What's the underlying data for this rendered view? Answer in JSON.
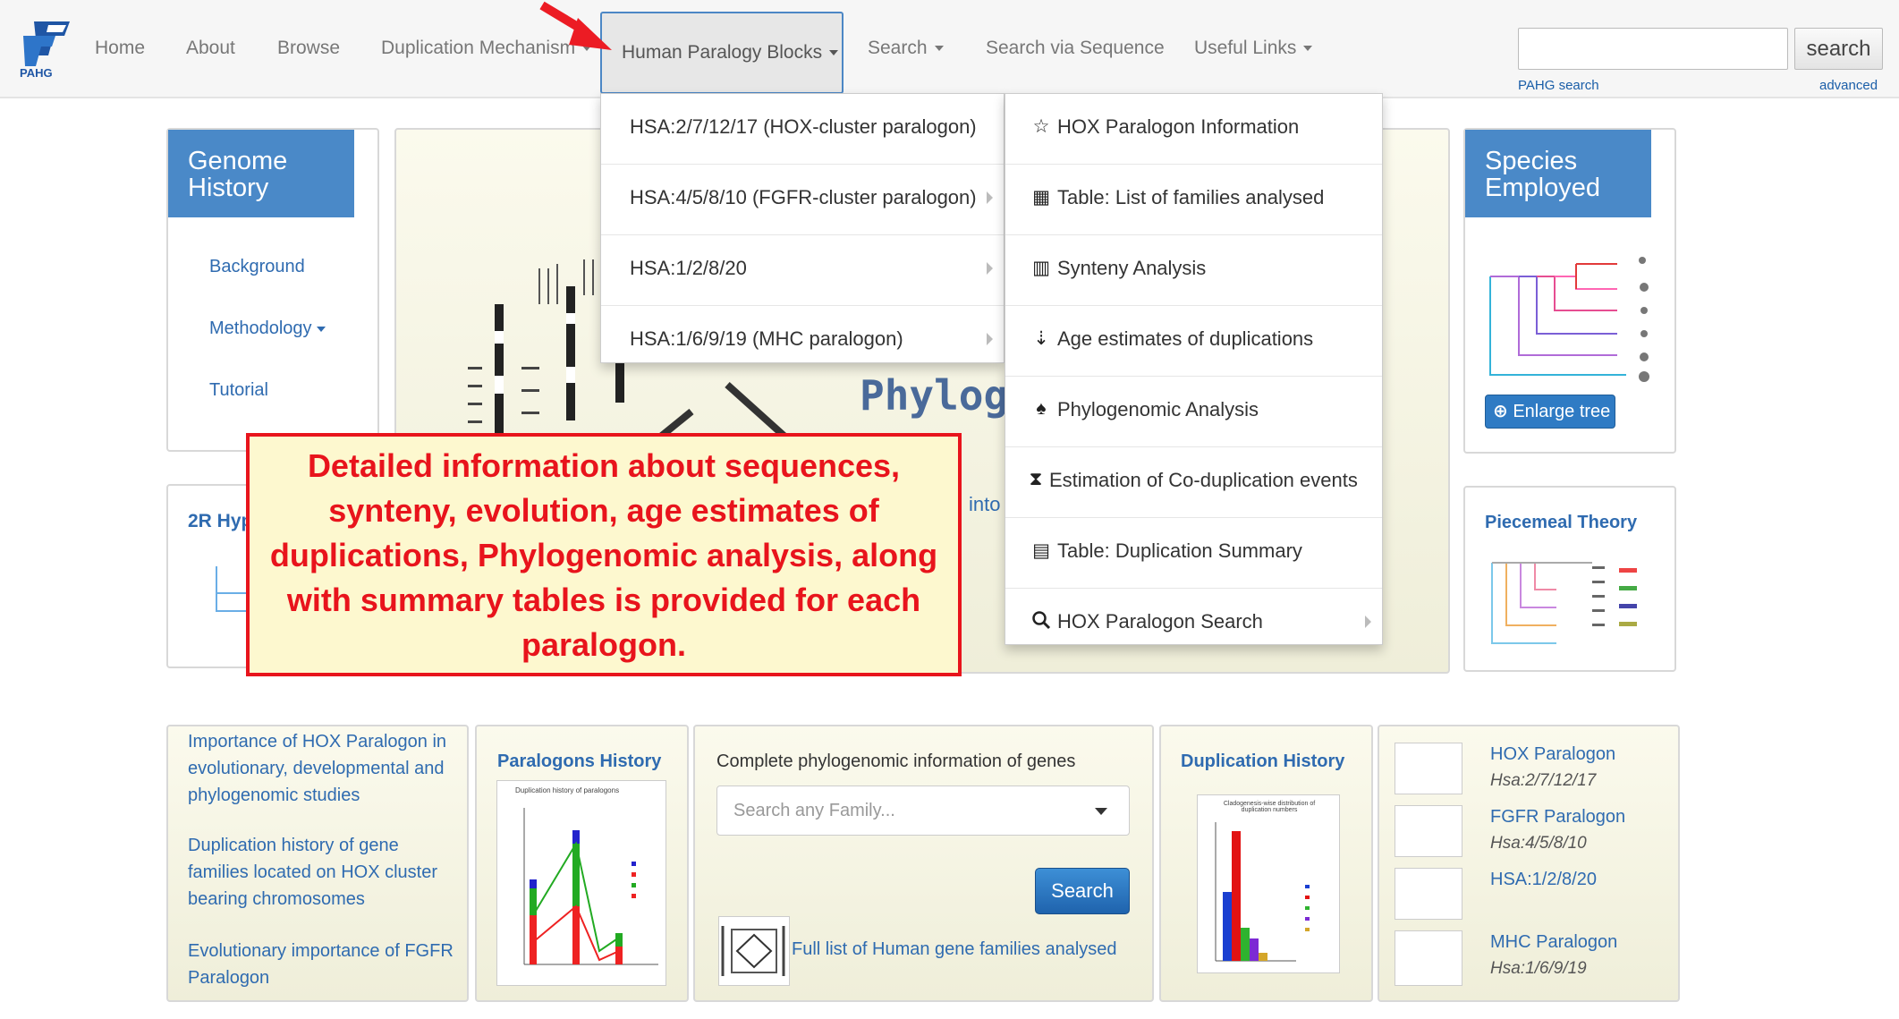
{
  "brand": {
    "logo_text": "PAHG"
  },
  "nav": {
    "home": "Home",
    "about": "About",
    "browse": "Browse",
    "duplication_mechanism": "Duplication Mechanism",
    "human_paralogy_blocks": "Human Paralogy Blocks",
    "search": "Search",
    "search_via_sequence": "Search via Sequence",
    "useful_links": "Useful Links"
  },
  "site_search": {
    "value": "",
    "button": "search",
    "pahg_search": "PAHG search",
    "advanced": "advanced"
  },
  "dropdown_blocks": [
    "HSA:2/7/12/17 (HOX-cluster paralogon)",
    "HSA:4/5/8/10 (FGFR-cluster paralogon)",
    "HSA:1/2/8/20",
    "HSA:1/6/9/19 (MHC paralogon)"
  ],
  "dropdown_hox": [
    {
      "icon": "star-icon",
      "glyph": "☆",
      "label": "HOX Paralogon Information"
    },
    {
      "icon": "table-icon",
      "glyph": "▦",
      "label": "Table: List of families analysed"
    },
    {
      "icon": "barcode-icon",
      "glyph": "▥",
      "label": "Synteny Analysis"
    },
    {
      "icon": "sort-icon",
      "glyph": "⇣",
      "label": "Age estimates of duplications"
    },
    {
      "icon": "tree-icon",
      "glyph": "♠",
      "label": "Phylogenomic Analysis"
    },
    {
      "icon": "hourglass-icon",
      "glyph": "⧗",
      "label": "Estimation of Co-duplication events"
    },
    {
      "icon": "list-icon",
      "glyph": "▤",
      "label": "Table: Duplication Summary"
    },
    {
      "icon": "search-icon",
      "glyph": "🔍",
      "label": "HOX Paralogon Search"
    }
  ],
  "genome_history": {
    "title": "Genome History",
    "links": [
      "Background",
      "Methodology",
      "Tutorial"
    ]
  },
  "hypothesis_panel": {
    "title": "2R Hyp"
  },
  "carousel": {
    "caption_fragment": "Phylog",
    "text_fragment": "into"
  },
  "species_employed": {
    "title": "Species Employed",
    "button": "Enlarge tree"
  },
  "piecemeal": {
    "title": "Piecemeal Theory"
  },
  "callout_text": "Detailed information about sequences, synteny, evolution, age estimates of duplications, Phylogenomic analysis, along with summary tables is provided for each paralogon.",
  "importance_links": [
    "Importance of HOX Paralogon in evolutionary, developmental and phylogenomic studies",
    "Duplication history of gene families located on HOX cluster bearing chromosomes",
    "Evolutionary importance of FGFR Paralogon"
  ],
  "paralogons_history": {
    "title": "Paralogons History",
    "chart_caption": "Duplication history of paralogons"
  },
  "family_search": {
    "title": "Complete phylogenomic information of genes",
    "placeholder": "Search any Family...",
    "button": "Search",
    "list_link": "Full list of Human gene families analysed"
  },
  "duplication_history": {
    "title": "Duplication History",
    "chart_caption": "Cladogenesis-wise distribution of duplication numbers"
  },
  "paralogons": [
    {
      "name": "HOX Paralogon",
      "chromosomes": "Hsa:2/7/12/17"
    },
    {
      "name": "FGFR Paralogon",
      "chromosomes": "Hsa:4/5/8/10"
    },
    {
      "name": "HSA:1/2/8/20",
      "chromosomes": ""
    },
    {
      "name": "MHC Paralogon",
      "chromosomes": "Hsa:1/6/9/19"
    }
  ]
}
